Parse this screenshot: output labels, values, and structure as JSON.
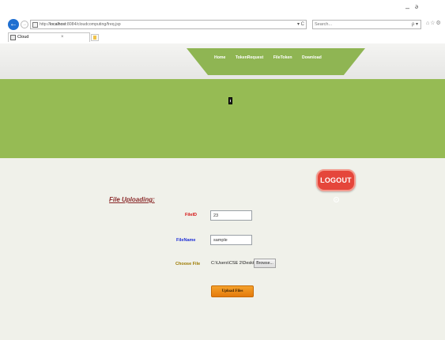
{
  "browser": {
    "url_prefix": "http://",
    "url_host": "localhost",
    "url_path": ":8084/cloudcomputing/freq.jsp",
    "url_actions": "▾ C",
    "search_placeholder": "Search...",
    "search_icon_glyph": "ρ ▾",
    "toolbar_icons": "⌂☆⚙",
    "window_minimize": "–",
    "window_maximize": "ə",
    "back_glyph": "←",
    "forward_glyph": "→",
    "tab": {
      "title": "Cloud",
      "close": "×"
    }
  },
  "nav": {
    "items": [
      "Home",
      "TokenRequest",
      "FileToken",
      "Download"
    ]
  },
  "logout": {
    "label": "LOGOUT",
    "icon_glyph": "»"
  },
  "form": {
    "title": "File Uploading:",
    "fileid_label": "FileID",
    "fileid_value": "23",
    "filename_label": "FileName",
    "filename_value": "sample",
    "choose_label": "Choose File",
    "file_path": "C:\\Users\\CSE 2\\Deskto",
    "browse_label": "Browse...",
    "upload_label": "Upload Files"
  },
  "colors": {
    "nav_green": "#8fb553",
    "banner_green": "#96bb54",
    "content_bg": "#f0f1ea",
    "logout_red": "#e5463b",
    "upload_orange": "#f5a22b",
    "fileid_label": "#d41212",
    "filename_label": "#1f2fd6",
    "choose_label": "#9c7a00",
    "title_color": "#8b2b2b"
  }
}
